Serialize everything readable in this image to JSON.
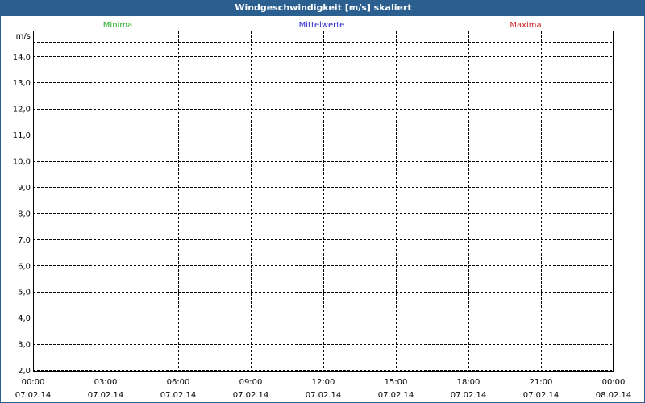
{
  "window": {
    "title": "Windgeschwindigkeit [m/s] skaliert"
  },
  "chart_data": {
    "type": "line",
    "title": "Windgeschwindigkeit [m/s] skaliert",
    "ylabel": "m/s",
    "xlabel": "",
    "ylim": [
      1.97,
      14.95
    ],
    "y_ticks": [
      "14,0",
      "13,0",
      "12,0",
      "11,0",
      "10,0",
      "9,0",
      "8,0",
      "7,0",
      "6,0",
      "5,0",
      "4,0",
      "3,0",
      "2,0"
    ],
    "y_tick_values": [
      14,
      13,
      12,
      11,
      10,
      9,
      8,
      7,
      6,
      5,
      4,
      3,
      2
    ],
    "x_ticks": [
      {
        "time": "00:00",
        "date": "07.02.14"
      },
      {
        "time": "03:00",
        "date": "07.02.14"
      },
      {
        "time": "06:00",
        "date": "07.02.14"
      },
      {
        "time": "09:00",
        "date": "07.02.14"
      },
      {
        "time": "12:00",
        "date": "07.02.14"
      },
      {
        "time": "15:00",
        "date": "07.02.14"
      },
      {
        "time": "18:00",
        "date": "07.02.14"
      },
      {
        "time": "21:00",
        "date": "07.02.14"
      },
      {
        "time": "00:00",
        "date": "08.02.14"
      }
    ],
    "grid": true,
    "legend_position": "top",
    "series": [
      {
        "name": "Minima",
        "color": "#22aa22",
        "values": []
      },
      {
        "name": "Mittelwerte",
        "color": "#2222cc",
        "values": []
      },
      {
        "name": "Maxima",
        "color": "#cc2222",
        "values": []
      }
    ]
  }
}
